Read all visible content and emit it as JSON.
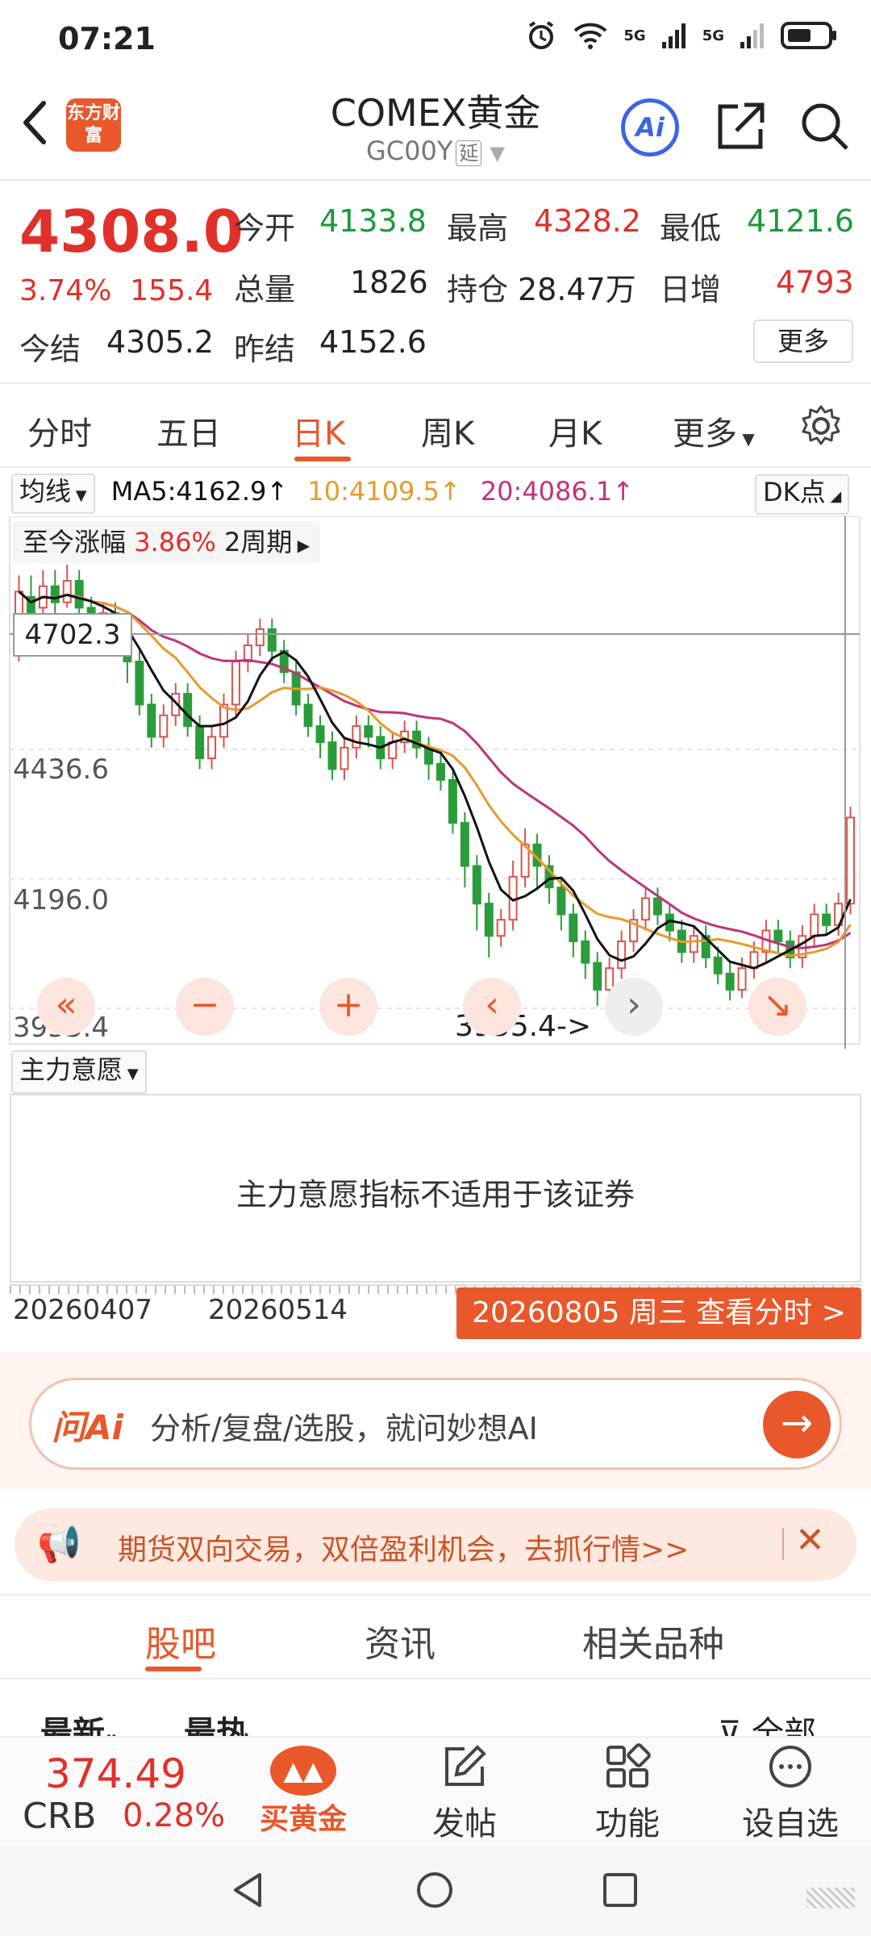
{
  "status": {
    "time": "07:21",
    "net1": "5G",
    "net2": "5G",
    "wifi_label": "6"
  },
  "header": {
    "logo": "东方财富",
    "title": "COMEX黄金",
    "code": "GC00Y",
    "code_tag": "延",
    "ai_label": "Ai"
  },
  "quote": {
    "price": "4308.0",
    "pct": "3.74%",
    "change": "155.4",
    "rows": [
      [
        {
          "label": "今开",
          "value": "4133.8",
          "color": "green"
        },
        {
          "label": "最高",
          "value": "4328.2",
          "color": "red"
        },
        {
          "label": "最低",
          "value": "4121.6",
          "color": "green"
        }
      ],
      [
        {
          "label": "总量",
          "value": "1826",
          "color": "dark"
        },
        {
          "label": "持仓",
          "value": "28.47万",
          "color": "dark"
        },
        {
          "label": "日增",
          "value": "4793",
          "color": "red"
        }
      ],
      [
        {
          "label": "今结",
          "value": "4305.2",
          "color": "dark"
        },
        {
          "label": "昨结",
          "value": "4152.6",
          "color": "dark"
        }
      ]
    ],
    "more": "更多"
  },
  "tabs": [
    "分时",
    "五日",
    "日K",
    "周K",
    "月K",
    "更多"
  ],
  "active_tab": "日K",
  "ma": {
    "selector": "均线",
    "ma5": "MA5:4162.9↑",
    "ma10": "10:4109.5↑",
    "ma20": "20:4086.1↑",
    "dk": "DK点"
  },
  "chart": {
    "range_label": "至今涨幅",
    "range_pct": "3.86%",
    "range_period": "2周期",
    "crosshair_value": "4702.3",
    "y_ticks": [
      "4436.6",
      "4196.0",
      "3955.4"
    ],
    "low_marker": "3955.4->",
    "colors": {
      "up": "#d9534f",
      "down": "#2a9d3a",
      "ma5": "#111111",
      "ma10": "#e89a2c",
      "ma20": "#c0337a"
    }
  },
  "chart_data": {
    "type": "candlestick",
    "x": [
      "20260407",
      "20260514"
    ],
    "ylim": [
      3955.4,
      4780
    ],
    "y_ticks": [
      4436.6,
      4196.0,
      3955.4
    ],
    "ma5": 4162.9,
    "ma10": 4109.5,
    "ma20": 4086.1,
    "candles": [
      [
        4640,
        4730,
        4600,
        4760
      ],
      [
        4720,
        4690,
        4660,
        4760
      ],
      [
        4700,
        4740,
        4680,
        4770
      ],
      [
        4740,
        4710,
        4690,
        4770
      ],
      [
        4710,
        4750,
        4700,
        4780
      ],
      [
        4750,
        4700,
        4680,
        4770
      ],
      [
        4700,
        4660,
        4640,
        4720
      ],
      [
        4660,
        4690,
        4640,
        4710
      ],
      [
        4690,
        4650,
        4630,
        4710
      ],
      [
        4650,
        4600,
        4560,
        4670
      ],
      [
        4600,
        4520,
        4500,
        4620
      ],
      [
        4520,
        4460,
        4440,
        4540
      ],
      [
        4460,
        4500,
        4440,
        4520
      ],
      [
        4500,
        4540,
        4480,
        4560
      ],
      [
        4540,
        4480,
        4460,
        4560
      ],
      [
        4480,
        4420,
        4400,
        4500
      ],
      [
        4420,
        4460,
        4400,
        4480
      ],
      [
        4460,
        4520,
        4440,
        4540
      ],
      [
        4520,
        4600,
        4500,
        4620
      ],
      [
        4600,
        4630,
        4580,
        4650
      ],
      [
        4630,
        4660,
        4610,
        4680
      ],
      [
        4660,
        4620,
        4600,
        4680
      ],
      [
        4620,
        4580,
        4560,
        4640
      ],
      [
        4580,
        4520,
        4500,
        4600
      ],
      [
        4520,
        4480,
        4460,
        4540
      ],
      [
        4480,
        4450,
        4420,
        4500
      ],
      [
        4450,
        4400,
        4380,
        4470
      ],
      [
        4400,
        4440,
        4380,
        4460
      ],
      [
        4440,
        4480,
        4420,
        4500
      ],
      [
        4480,
        4460,
        4440,
        4500
      ],
      [
        4460,
        4420,
        4400,
        4480
      ],
      [
        4420,
        4450,
        4400,
        4470
      ],
      [
        4450,
        4470,
        4430,
        4490
      ],
      [
        4470,
        4440,
        4420,
        4490
      ],
      [
        4440,
        4410,
        4380,
        4460
      ],
      [
        4410,
        4380,
        4360,
        4430
      ],
      [
        4380,
        4300,
        4280,
        4400
      ],
      [
        4300,
        4220,
        4180,
        4320
      ],
      [
        4220,
        4150,
        4100,
        4240
      ],
      [
        4150,
        4090,
        4050,
        4170
      ],
      [
        4090,
        4120,
        4070,
        4140
      ],
      [
        4120,
        4200,
        4100,
        4230
      ],
      [
        4200,
        4260,
        4180,
        4290
      ],
      [
        4260,
        4220,
        4180,
        4280
      ],
      [
        4220,
        4180,
        4150,
        4240
      ],
      [
        4180,
        4130,
        4100,
        4200
      ],
      [
        4130,
        4080,
        4050,
        4150
      ],
      [
        4080,
        4040,
        4010,
        4100
      ],
      [
        4040,
        3990,
        3960,
        4060
      ],
      [
        3990,
        4030,
        3955,
        4050
      ],
      [
        4030,
        4080,
        4010,
        4100
      ],
      [
        4080,
        4120,
        4060,
        4140
      ],
      [
        4120,
        4160,
        4100,
        4180
      ],
      [
        4160,
        4130,
        4110,
        4180
      ],
      [
        4130,
        4100,
        4080,
        4150
      ],
      [
        4100,
        4060,
        4040,
        4120
      ],
      [
        4060,
        4090,
        4040,
        4110
      ],
      [
        4090,
        4050,
        4030,
        4110
      ],
      [
        4050,
        4020,
        4000,
        4070
      ],
      [
        4020,
        3990,
        3970,
        4040
      ],
      [
        3990,
        4030,
        3975,
        4050
      ],
      [
        4030,
        4060,
        4010,
        4080
      ],
      [
        4060,
        4100,
        4040,
        4120
      ],
      [
        4100,
        4080,
        4060,
        4120
      ],
      [
        4080,
        4050,
        4030,
        4100
      ],
      [
        4050,
        4090,
        4030,
        4110
      ],
      [
        4090,
        4130,
        4070,
        4150
      ],
      [
        4130,
        4110,
        4090,
        4150
      ],
      [
        4110,
        4150,
        4090,
        4170
      ],
      [
        4150,
        4310,
        4130,
        4330
      ]
    ]
  },
  "zlyy": {
    "selector": "主力意愿",
    "message": "主力意愿指标不适用于该证券"
  },
  "dates": {
    "d1": "20260407",
    "d2": "20260514",
    "badge": "20260805 周三 查看分时 >"
  },
  "ai_bar": {
    "logo": "问Ai",
    "placeholder": "分析/复盘/选股，就问妙想AI"
  },
  "promo": {
    "text": "期货双向交易，双倍盈利机会，去抓行情>>"
  },
  "bottom_tabs": [
    "股吧",
    "资讯",
    "相关品种"
  ],
  "sub_tabs": {
    "latest": "最新",
    "hot": "最热",
    "all": "全部"
  },
  "bottom_nav": {
    "crb_value": "374.49",
    "crb_name": "CRB",
    "crb_pct": "0.28%",
    "buy_gold": "买黄金",
    "post": "发帖",
    "func": "功能",
    "watch": "设自选"
  }
}
